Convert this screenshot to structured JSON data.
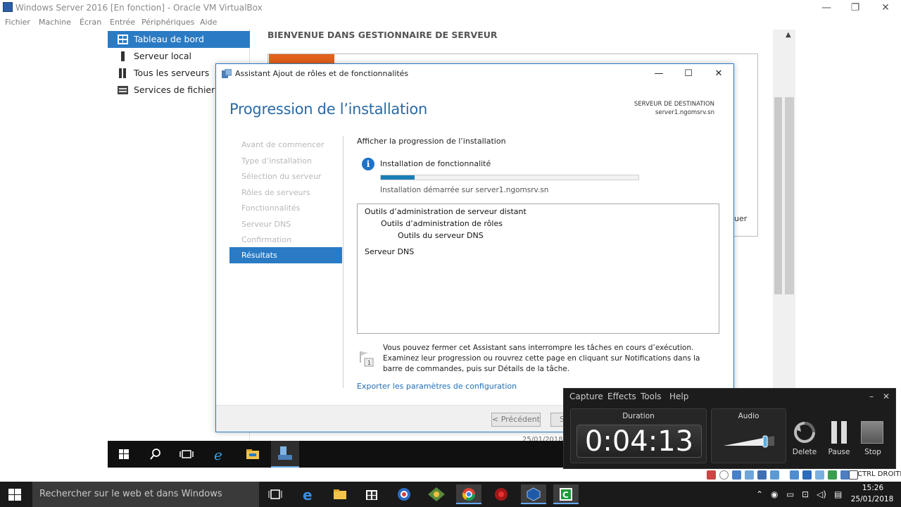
{
  "vbox": {
    "title": "Windows Server 2016 [En fonction] - Oracle VM VirtualBox",
    "menu": [
      "Fichier",
      "Machine",
      "Écran",
      "Entrée",
      "Périphériques",
      "Aide"
    ],
    "status_key": "CTRL DROITE"
  },
  "server_manager": {
    "nav": [
      {
        "label": "Tableau de bord",
        "icon": "dashboard-icon"
      },
      {
        "label": "Serveur local",
        "icon": "server-icon"
      },
      {
        "label": "Tous les serveurs",
        "icon": "servers-icon"
      },
      {
        "label": "Services de fichiers et de stockage",
        "icon": "storage-icon"
      }
    ],
    "welcome": "BIENVENUE DANS GESTIONNAIRE DE SERVEUR",
    "bg_partial_text": "uer",
    "bg_date": "25/01/2018"
  },
  "wizard": {
    "title": "Assistant Ajout de rôles et de fonctionnalités",
    "heading": "Progression de l’installation",
    "dest_label": "SERVEUR DE DESTINATION",
    "dest_server": "server1.ngomsrv.sn",
    "steps": [
      "Avant de commencer",
      "Type d’installation",
      "Sélection du serveur",
      "Rôles de serveurs",
      "Fonctionnalités",
      "Serveur DNS",
      "Confirmation",
      "Résultats"
    ],
    "active_step": "Résultats",
    "progress_title": "Afficher la progression de l’installation",
    "progress_label": "Installation de fonctionnalité",
    "progress_fraction": 0.13,
    "progress_started": "Installation démarrée sur server1.ngomsrv.sn",
    "features": [
      {
        "label": "Outils d’administration de serveur distant",
        "level": 0
      },
      {
        "label": "Outils d’administration de rôles",
        "level": 1
      },
      {
        "label": "Outils du serveur DNS",
        "level": 2
      },
      {
        "label": "Serveur DNS",
        "level": 0
      }
    ],
    "note": "Vous pouvez fermer cet Assistant sans interrompre les tâches en cours d’exécution. Examinez leur progression ou rouvrez cette page en cliquant sur Notifications dans la barre de commandes, puis sur Détails de la tâche.",
    "export_link": "Exporter les paramètres de configuration",
    "btn_prev": "< Précédent",
    "btn_next": "Su"
  },
  "host_taskbar": {
    "search_placeholder": "Rechercher sur le web et dans Windows",
    "time": "15:26",
    "date": "25/01/2018"
  },
  "recorder": {
    "menu": [
      "Capture",
      "Effects",
      "Tools",
      "Help"
    ],
    "duration_label": "Duration",
    "duration": "0:04:13",
    "audio_label": "Audio",
    "audio_level": 0.82,
    "btn_delete": "Delete",
    "btn_pause": "Pause",
    "btn_stop": "Stop"
  },
  "colors": {
    "accent": "#2a7bc4",
    "progress": "#1a7fb5",
    "orange": "#e2621c"
  }
}
